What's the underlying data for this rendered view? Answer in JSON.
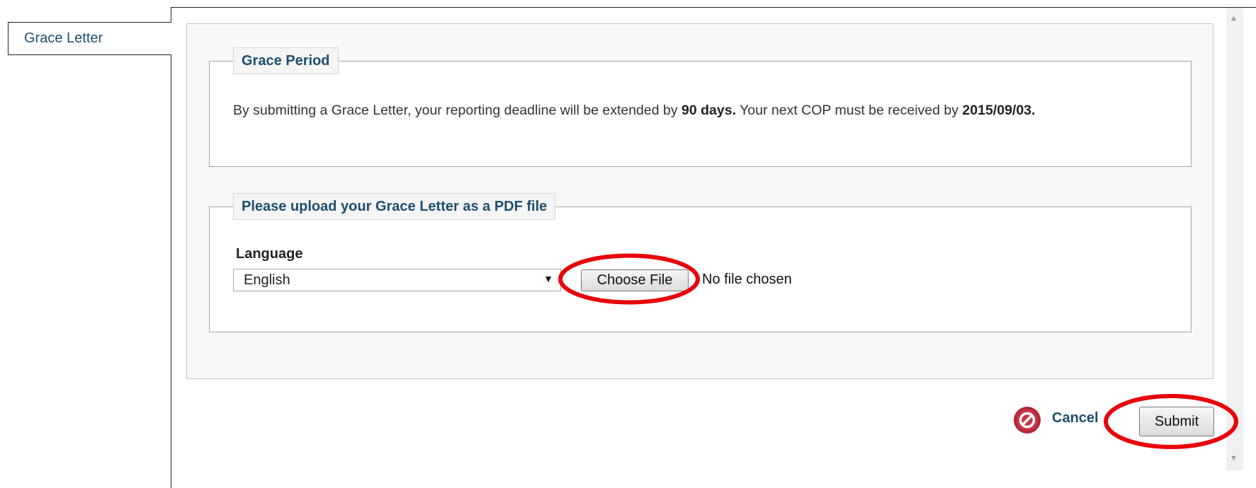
{
  "tab": {
    "label": "Grace Letter"
  },
  "grace_period": {
    "legend": "Grace Period",
    "text_prefix": "By submitting a Grace Letter, your reporting deadline will be extended by ",
    "extension": "90 days.",
    "text_middle": " Your next COP must be received by ",
    "deadline": "2015/09/03."
  },
  "upload": {
    "legend": "Please upload your Grace Letter as a PDF file",
    "language_label": "Language",
    "language_value": "English",
    "choose_file_label": "Choose File",
    "file_status": "No file chosen"
  },
  "actions": {
    "cancel_label": "Cancel",
    "submit_label": "Submit"
  },
  "icons": {
    "cancel": "cancel-circle-icon",
    "dropdown": "dropdown-arrow-icon"
  },
  "colors": {
    "link": "#1c4f6e",
    "annotation": "#e8000b",
    "cancel_icon": "#b0283a"
  }
}
